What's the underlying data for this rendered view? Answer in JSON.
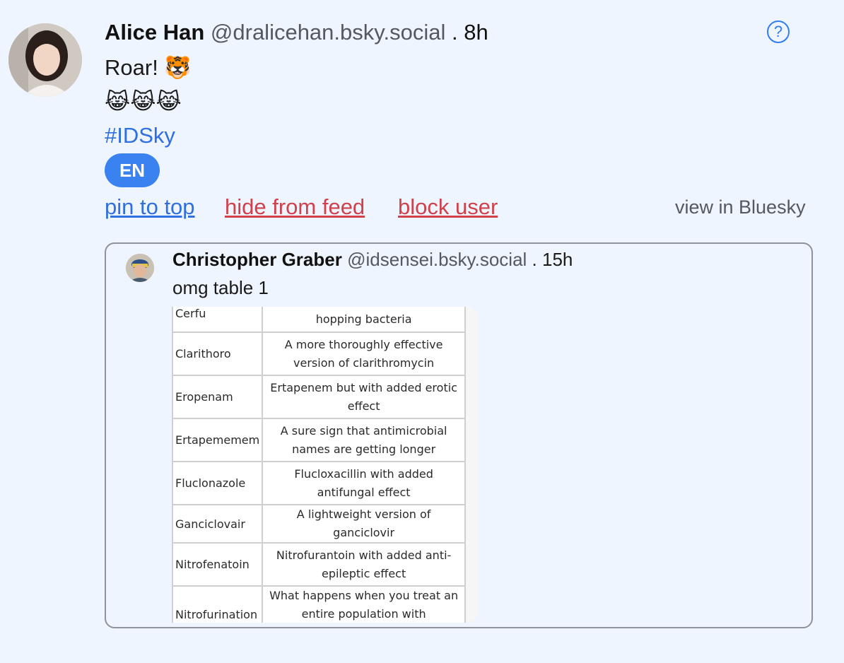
{
  "post": {
    "author_name": "Alice Han",
    "author_handle": "@dralicehan.bsky.social",
    "separator": ".",
    "time": "8h",
    "text_line1": "Roar! 🐯",
    "text_line2": "😹😹😹",
    "hashtag": "#IDSky",
    "language_badge": "EN",
    "help_icon_glyph": "?"
  },
  "actions": {
    "pin_label": "pin to top",
    "hide_label": "hide from feed",
    "block_label": "block user",
    "view_label": "view in Bluesky"
  },
  "quoted_post": {
    "author_name": "Christopher Graber",
    "author_handle": "@idsensei.bsky.social",
    "separator": ".",
    "time": "15h",
    "text": "omg table 1",
    "table_rows": [
      {
        "name": "Cerfu",
        "desc": "hopping bacteria"
      },
      {
        "name": "Clarithoro",
        "desc": "A more thoroughly effective version of clarithromycin"
      },
      {
        "name": "Eropenam",
        "desc": "Ertapenem but with added erotic effect"
      },
      {
        "name": "Ertapememem",
        "desc": "A sure sign that antimicrobial names are getting longer"
      },
      {
        "name": "Fluclonazole",
        "desc": "Flucloxacillin with added antifungal effect"
      },
      {
        "name": "Ganciclovair",
        "desc": "A lightweight version of ganciclovir"
      },
      {
        "name": "Nitrofenatoin",
        "desc": "Nitrofurantoin with added anti-epileptic effect"
      },
      {
        "name": "Nitrofurination",
        "desc": "What happens when you treat an entire population with nitrofurantoin"
      }
    ]
  },
  "colors": {
    "background": "#eff5fe",
    "link_blue": "#2f6fe0",
    "danger_red": "#d0414b",
    "badge_blue": "#3a82f0"
  }
}
